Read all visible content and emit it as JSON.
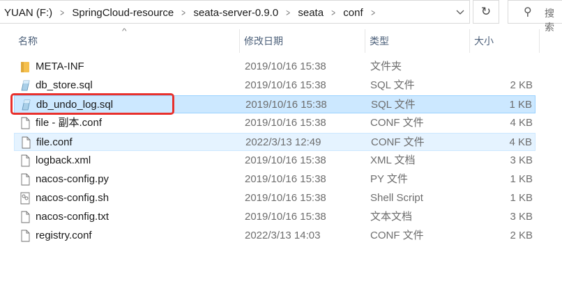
{
  "breadcrumb": [
    "YUAN (F:)",
    "SpringCloud-resource",
    "seata-server-0.9.0",
    "seata",
    "conf"
  ],
  "search": {
    "placeholder": "搜索"
  },
  "columns": {
    "name": "名称",
    "date": "修改日期",
    "type": "类型",
    "size": "大小"
  },
  "files": [
    {
      "name": "META-INF",
      "date": "2019/10/16 15:38",
      "type": "文件夹",
      "size": "",
      "icon": "folder-icon"
    },
    {
      "name": "db_store.sql",
      "date": "2019/10/16 15:38",
      "type": "SQL 文件",
      "size": "2 KB",
      "icon": "sql-file-icon"
    },
    {
      "name": "db_undo_log.sql",
      "date": "2019/10/16 15:38",
      "type": "SQL 文件",
      "size": "1 KB",
      "icon": "sql-file-icon",
      "state": "selected"
    },
    {
      "name": "file - 副本.conf",
      "date": "2019/10/16 15:38",
      "type": "CONF 文件",
      "size": "4 KB",
      "icon": "file-icon"
    },
    {
      "name": "file.conf",
      "date": "2022/3/13 12:49",
      "type": "CONF 文件",
      "size": "4 KB",
      "icon": "file-icon",
      "state": "hover"
    },
    {
      "name": "logback.xml",
      "date": "2019/10/16 15:38",
      "type": "XML 文档",
      "size": "3 KB",
      "icon": "file-icon"
    },
    {
      "name": "nacos-config.py",
      "date": "2019/10/16 15:38",
      "type": "PY 文件",
      "size": "1 KB",
      "icon": "file-icon"
    },
    {
      "name": "nacos-config.sh",
      "date": "2019/10/16 15:38",
      "type": "Shell Script",
      "size": "1 KB",
      "icon": "shell-script-icon"
    },
    {
      "name": "nacos-config.txt",
      "date": "2019/10/16 15:38",
      "type": "文本文档",
      "size": "3 KB",
      "icon": "file-icon"
    },
    {
      "name": "registry.conf",
      "date": "2022/3/13 14:03",
      "type": "CONF 文件",
      "size": "2 KB",
      "icon": "file-icon"
    }
  ],
  "colors": {
    "selected": "#cce8ff",
    "hover": "#e5f3ff",
    "highlight": "#e8302c",
    "folder": "#f5c04e"
  }
}
